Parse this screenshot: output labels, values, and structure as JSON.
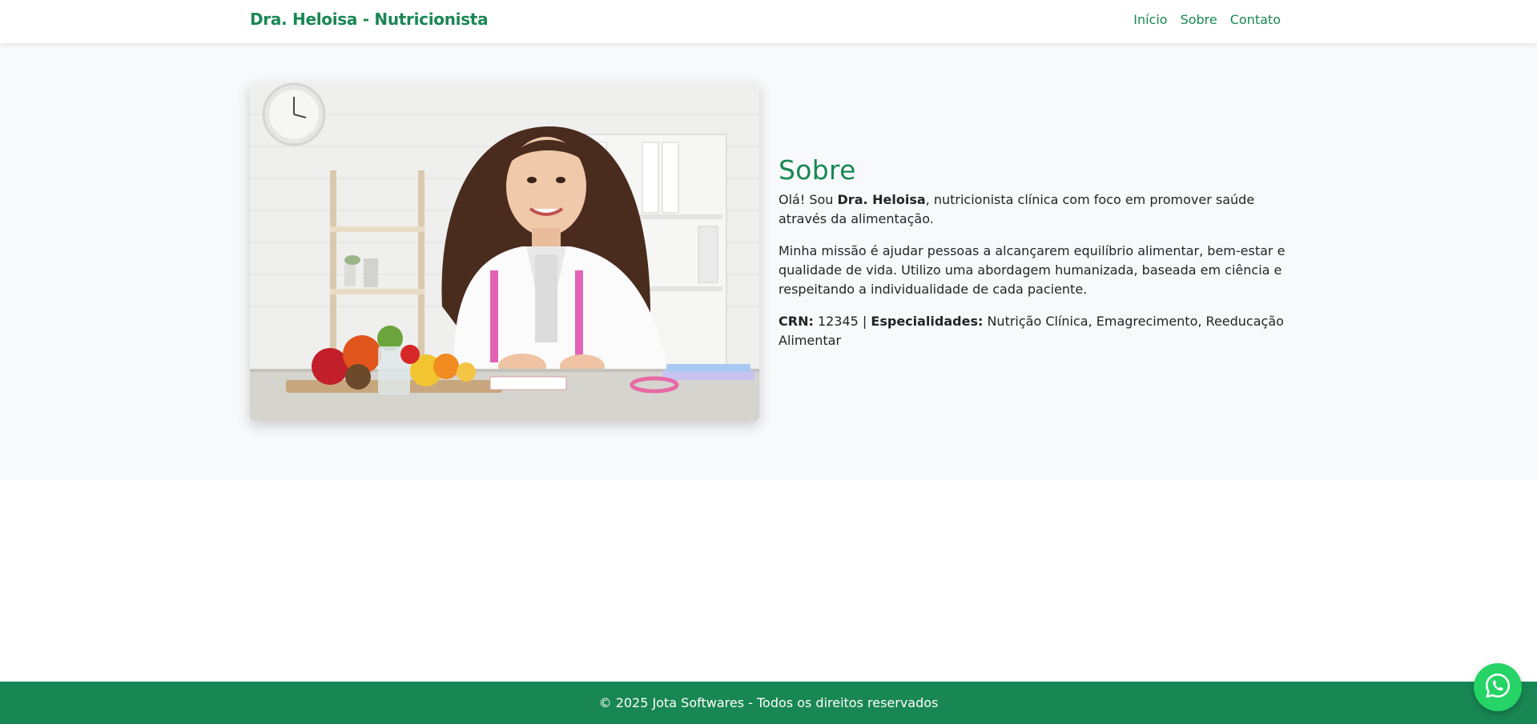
{
  "navbar": {
    "brand": "Dra. Heloisa - Nutricionista",
    "links": [
      "Início",
      "Sobre",
      "Contato"
    ]
  },
  "about": {
    "title": "Sobre",
    "intro": {
      "pre": "Olá! Sou ",
      "name": "Dra. Heloisa",
      "post": ", nutricionista clínica com foco em promover saúde através da alimentação."
    },
    "mission": "Minha missão é ajudar pessoas a alcançarem equilíbrio alimentar, bem-estar e qualidade de vida. Utilizo uma abordagem humanizada, baseada em ciência e respeitando a individualidade de cada paciente.",
    "crn_label": "CRN:",
    "crn_value": " 12345 | ",
    "specialties_label": "Especialidades:",
    "specialties_value": " Nutrição Clínica, Emagrecimento, Reeducação Alimentar"
  },
  "footer": {
    "text": "© 2025 Jota Softwares - Todos os direitos reservados"
  },
  "colors": {
    "accent": "#198754",
    "whatsapp": "#25d366",
    "section_bg": "#f8f9fa"
  },
  "icons": {
    "whatsapp": "whatsapp-icon"
  }
}
